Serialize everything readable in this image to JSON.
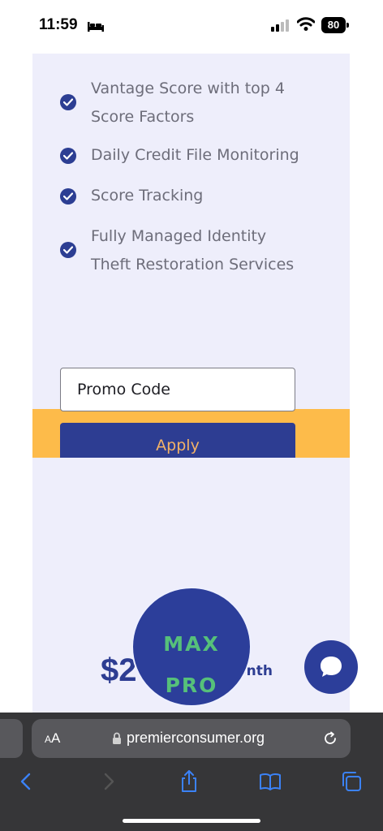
{
  "status_bar": {
    "time": "11:59",
    "battery": "80"
  },
  "features": [
    {
      "lines": [
        "Vantage Score with top 4",
        "Score Factors"
      ]
    },
    {
      "lines": [
        "Daily Credit File Monitoring"
      ]
    },
    {
      "lines": [
        "Score Tracking"
      ]
    },
    {
      "lines": [
        "Fully Managed Identity",
        "Theft Restoration Services"
      ]
    }
  ],
  "promo": {
    "value": "Promo Code",
    "apply_label": "Apply"
  },
  "pricing": {
    "price_partial": "$2",
    "per_month_partial": "onth"
  },
  "plan_badge": {
    "line1": "MAX",
    "line2": "PRO"
  },
  "browser": {
    "aa_label_small": "A",
    "aa_label": "A",
    "url": "premierconsumer.org"
  },
  "colors": {
    "brand_blue": "#2c3e93",
    "card_bg": "#eeeefb",
    "accent_yellow": "#fdbb4a",
    "badge_green": "#56c07a"
  },
  "icons": [
    "bed-icon",
    "signal-icon",
    "wifi-icon",
    "battery-icon",
    "check-circle-icon",
    "chat-icon",
    "lock-icon",
    "reload-icon",
    "back-icon",
    "forward-icon",
    "share-icon",
    "bookmarks-icon",
    "tabs-icon"
  ]
}
